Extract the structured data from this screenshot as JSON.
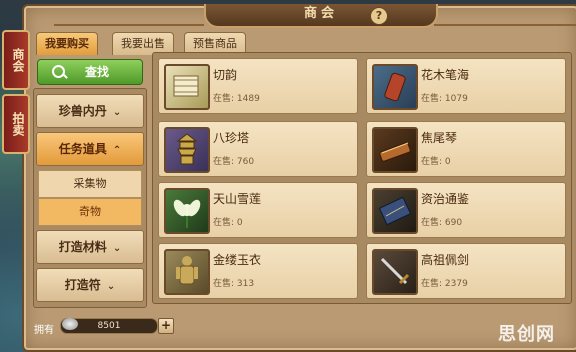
{
  "window": {
    "title": "商会",
    "help": "?"
  },
  "side_tabs": [
    "商会",
    "拍卖"
  ],
  "tabs": [
    {
      "label": "我要购买",
      "active": true
    },
    {
      "label": "我要出售",
      "active": false
    },
    {
      "label": "预售商品",
      "active": false
    }
  ],
  "search_label": "查找",
  "categories": [
    {
      "label": "珍兽内丹",
      "chevron": "⌄"
    },
    {
      "label": "任务道具",
      "chevron": "⌃",
      "open": true
    },
    {
      "label": "打造材料",
      "chevron": "⌄"
    },
    {
      "label": "打造符",
      "chevron": "⌄"
    }
  ],
  "subcategories": [
    {
      "label": "采集物",
      "selected": false
    },
    {
      "label": "奇物",
      "selected": true
    }
  ],
  "items": [
    {
      "name": "切韵",
      "stock_label": "在售",
      "stock": "1489",
      "icon": "book-scroll-icon"
    },
    {
      "name": "花木笔海",
      "stock_label": "在售",
      "stock": "1079",
      "icon": "brush-pot-icon"
    },
    {
      "name": "八珍塔",
      "stock_label": "在售",
      "stock": "760",
      "icon": "pagoda-icon"
    },
    {
      "name": "焦尾琴",
      "stock_label": "在售",
      "stock": "0",
      "icon": "zither-icon"
    },
    {
      "name": "天山雪莲",
      "stock_label": "在售",
      "stock": "0",
      "icon": "snow-lotus-icon"
    },
    {
      "name": "资治通鉴",
      "stock_label": "在售",
      "stock": "690",
      "icon": "ancient-book-icon"
    },
    {
      "name": "金缕玉衣",
      "stock_label": "在售",
      "stock": "313",
      "icon": "jade-suit-icon"
    },
    {
      "name": "高祖佩剑",
      "stock_label": "在售",
      "stock": "2379",
      "icon": "sword-icon"
    }
  ],
  "footer": {
    "own_label": "拥有",
    "silver": "8501",
    "plus": "+"
  },
  "watermark": "思创网"
}
